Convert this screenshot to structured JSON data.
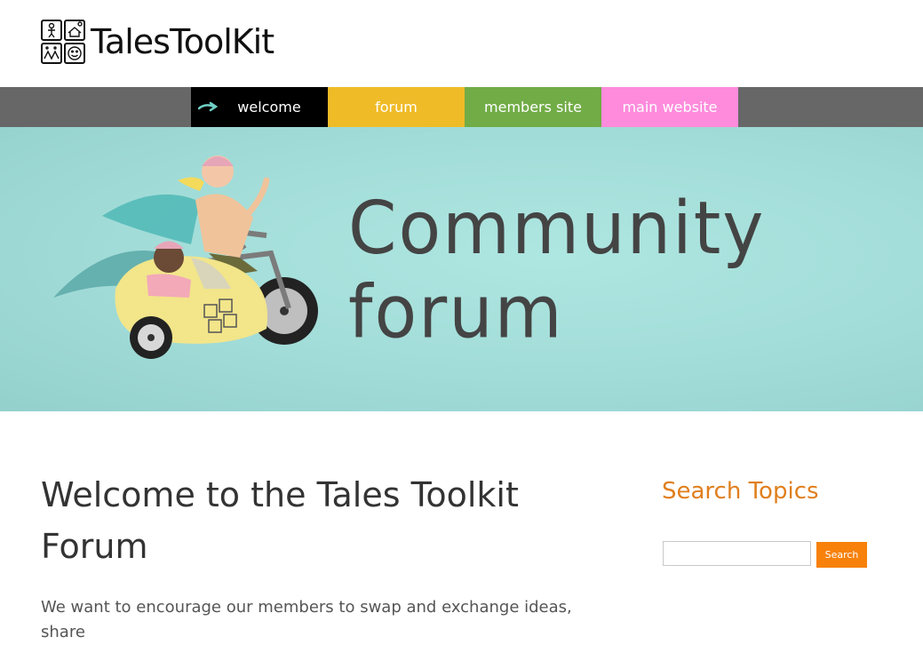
{
  "brand": {
    "name": "TalesToolKit"
  },
  "nav": {
    "items": [
      {
        "label": "welcome",
        "color": "#000000"
      },
      {
        "label": "forum",
        "color": "#efbb27"
      },
      {
        "label": "members site",
        "color": "#71ac46"
      },
      {
        "label": "main website",
        "color": "#fe8bdc"
      }
    ]
  },
  "hero": {
    "title": "Community forum"
  },
  "main": {
    "heading": "Welcome to the Tales Toolkit Forum",
    "intro": "We want to encourage our members to swap and exchange ideas, share"
  },
  "sidebar": {
    "title": "Search Topics",
    "search_placeholder": "",
    "search_button": "Search"
  },
  "colors": {
    "nav_bar": "#676767",
    "hero_bg": "#a2dcd8",
    "accent_orange": "#f7810a",
    "sidebar_title": "#e07f1d"
  }
}
